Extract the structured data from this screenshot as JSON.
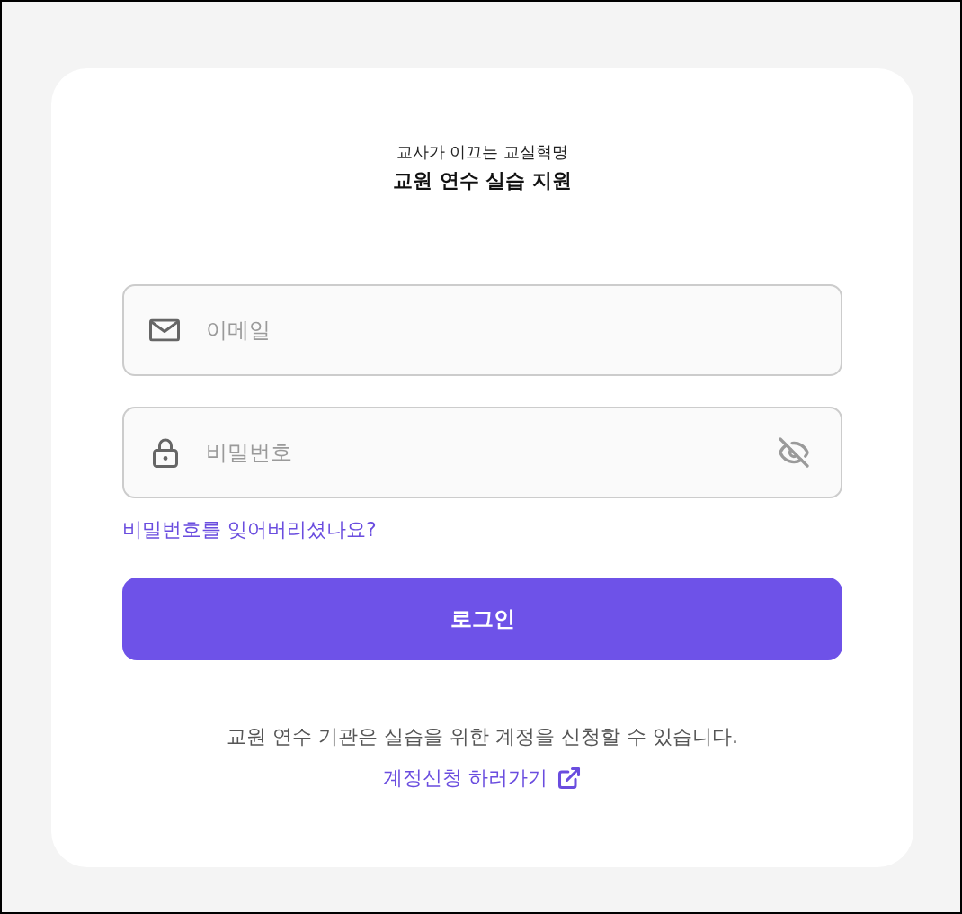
{
  "header": {
    "subtitle": "교사가 이끄는 교실혁명",
    "title": "교원 연수 실습 지원"
  },
  "fields": [
    {
      "kind": "email",
      "placeholder": "이메일"
    },
    {
      "kind": "password",
      "placeholder": "비밀번호"
    }
  ],
  "forgot_password_link": "비밀번호를 잊어버리셨나요?",
  "login_button": "로그인",
  "footer": {
    "note": "교원 연수 기관은 실습을 위한 계정을 신청할 수 있습니다.",
    "signup_link": "계정신청 하러가기"
  }
}
